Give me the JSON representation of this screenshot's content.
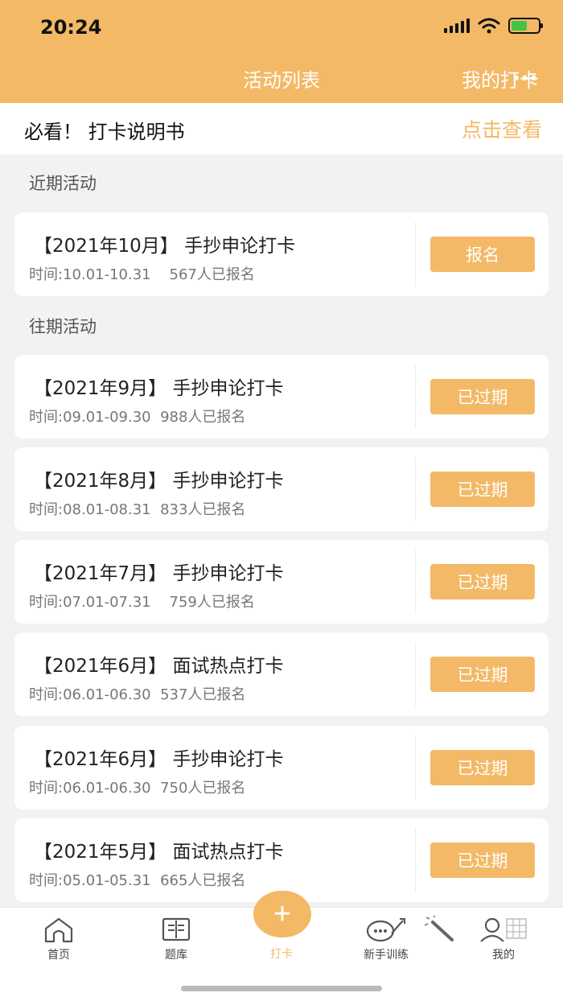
{
  "status": {
    "time": "20:24"
  },
  "nav": {
    "title": "活动列表",
    "right": "我的打卡",
    "dots": "•••"
  },
  "guide": {
    "title": "必看！ 打卡说明书",
    "link": "点击查看"
  },
  "sections": {
    "recent": "近期活动",
    "past": "往期活动"
  },
  "recent": [
    {
      "title": "【2021年10月】 手抄申论打卡",
      "time": "时间:10.01-10.31",
      "count": "567人已报名",
      "button": "报名"
    }
  ],
  "past": [
    {
      "title": "【2021年9月】 手抄申论打卡",
      "time": "时间:09.01-09.30",
      "count": "988人已报名",
      "button": "已过期"
    },
    {
      "title": "【2021年8月】 手抄申论打卡",
      "time": "时间:08.01-08.31",
      "count": "833人已报名",
      "button": "已过期"
    },
    {
      "title": "【2021年7月】 手抄申论打卡",
      "time": "时间:07.01-07.31",
      "count": "759人已报名",
      "button": "已过期"
    },
    {
      "title": "【2021年6月】 面试热点打卡",
      "time": "时间:06.01-06.30",
      "count": "537人已报名",
      "button": "已过期"
    },
    {
      "title": "【2021年6月】 手抄申论打卡",
      "time": "时间:06.01-06.30",
      "count": "750人已报名",
      "button": "已过期"
    },
    {
      "title": "【2021年5月】 面试热点打卡",
      "time": "时间:05.01-05.31",
      "count": "665人已报名",
      "button": "已过期"
    }
  ],
  "tabs": {
    "home": "首页",
    "bank": "题库",
    "checkin": "打卡",
    "training": "新手训练",
    "mine": "我的",
    "plus": "+"
  },
  "colors": {
    "accent": "#f3b966",
    "background": "#f2f2f2"
  }
}
